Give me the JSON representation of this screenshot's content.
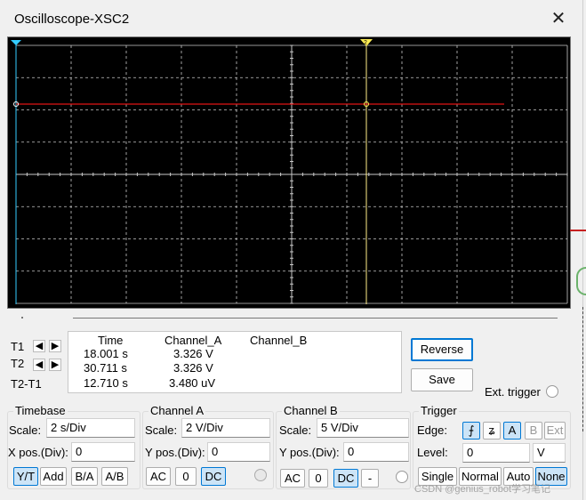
{
  "window": {
    "title": "Oscilloscope-XSC2",
    "close_icon": "close-icon"
  },
  "screen": {
    "background": "#000000",
    "grid_color": "#c8c8c8",
    "trace_color": "#e01414",
    "cursor1_color": "#33ccff",
    "cursor2_color": "#ffee55",
    "cursor1_label": "1",
    "cursor2_label": "2"
  },
  "cursors": {
    "t1_label": "T1",
    "t2_label": "T2",
    "diff_label": "T2-T1"
  },
  "readout": {
    "headers": [
      "Time",
      "Channel_A",
      "Channel_B"
    ],
    "rows": [
      {
        "time": "18.001 s",
        "a": "3.326 V",
        "b": ""
      },
      {
        "time": "30.711 s",
        "a": "3.326 V",
        "b": ""
      },
      {
        "time": "12.710 s",
        "a": "3.480 uV",
        "b": ""
      }
    ]
  },
  "actions": {
    "reverse": "Reverse",
    "save": "Save",
    "ext_trigger": "Ext. trigger"
  },
  "timebase": {
    "title": "Timebase",
    "scale_label": "Scale:",
    "scale": "2 s/Div",
    "xpos_label": "X pos.(Div):",
    "xpos": "0",
    "modes": [
      "Y/T",
      "Add",
      "B/A",
      "A/B"
    ],
    "selected_mode": "Y/T"
  },
  "channel_a": {
    "title": "Channel A",
    "scale_label": "Scale:",
    "scale": "2 V/Div",
    "ypos_label": "Y pos.(Div):",
    "ypos": "0",
    "coupling": [
      "AC",
      "0",
      "DC"
    ],
    "selected": "DC"
  },
  "channel_b": {
    "title": "Channel B",
    "scale_label": "Scale:",
    "scale": "5 V/Div",
    "ypos_label": "Y pos.(Div):",
    "ypos": "0",
    "coupling": [
      "AC",
      "0",
      "DC",
      "-"
    ],
    "selected": "DC"
  },
  "trigger": {
    "title": "Trigger",
    "edge_label": "Edge:",
    "edge_sources": [
      "A",
      "B",
      "Ext"
    ],
    "selected_source": "A",
    "level_label": "Level:",
    "level": "0",
    "level_unit": "V",
    "modes": [
      "Single",
      "Normal",
      "Auto",
      "None"
    ],
    "selected_mode": "None"
  },
  "watermark": "CSDN @genius_robot学习笔记"
}
